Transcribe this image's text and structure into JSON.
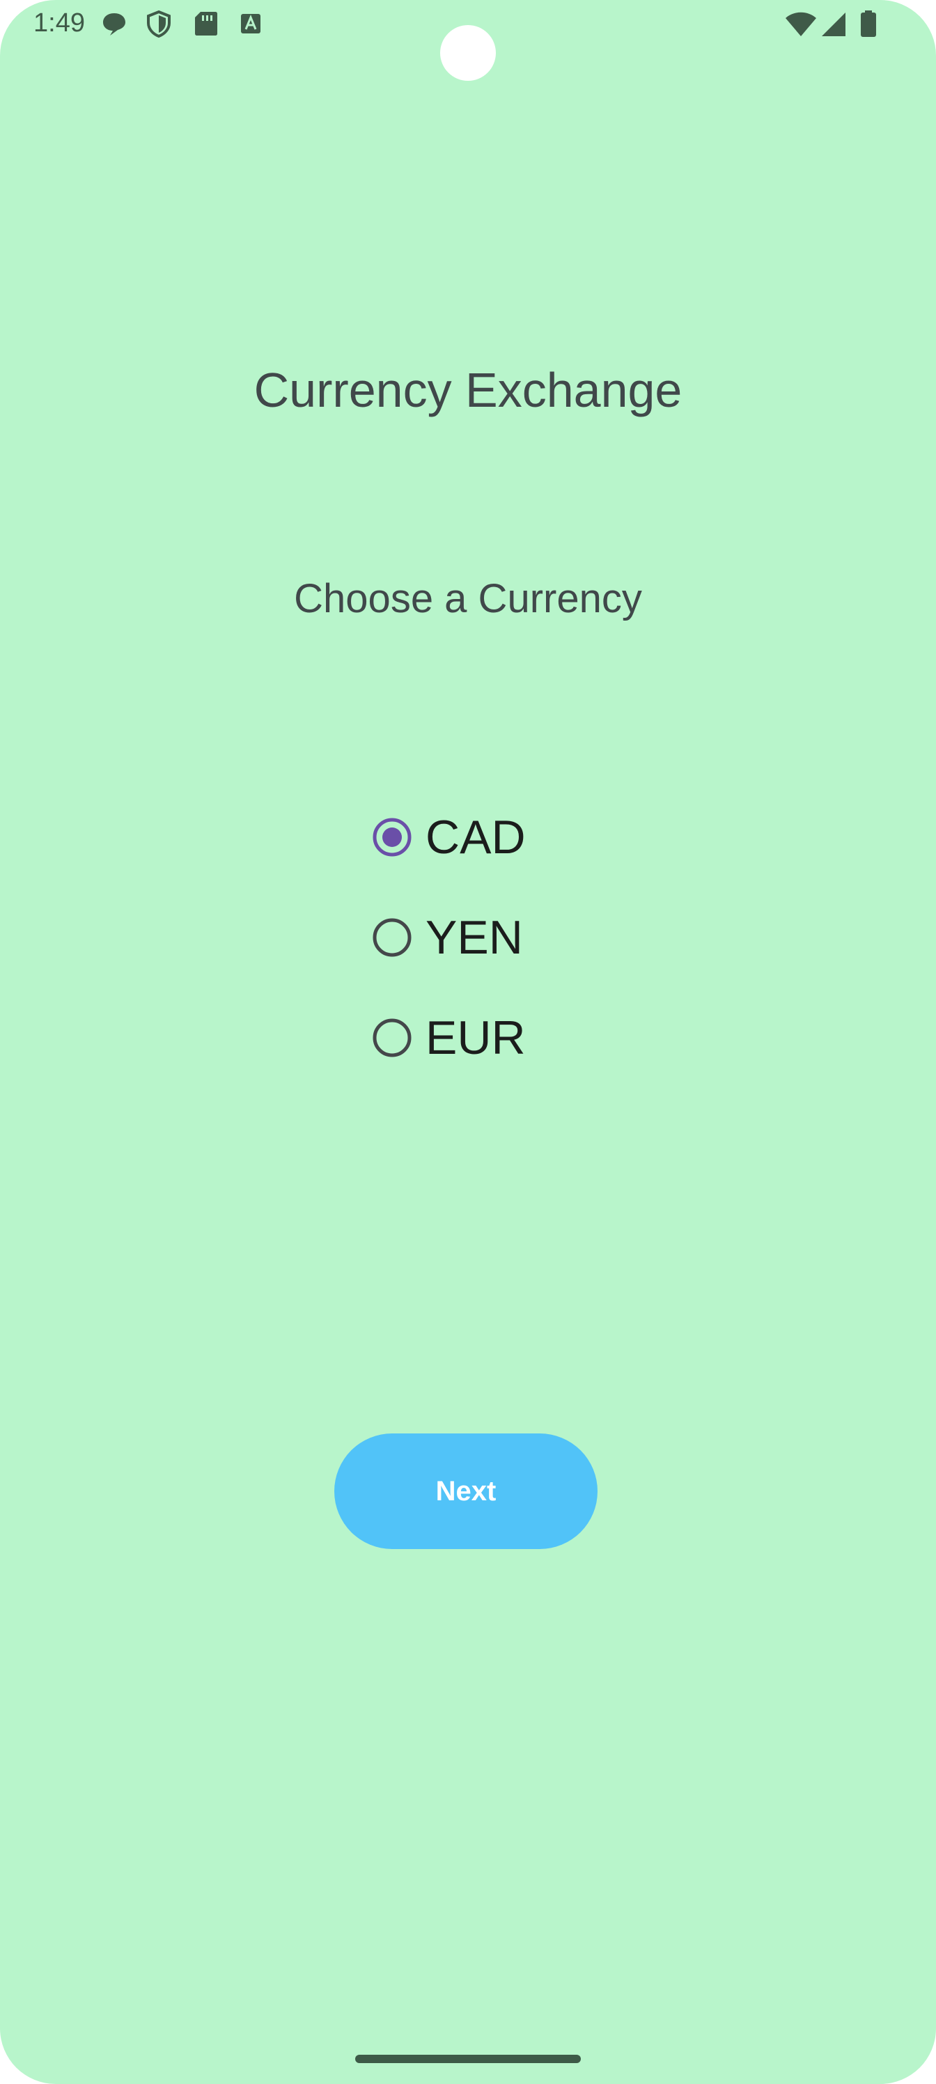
{
  "status_bar": {
    "time": "1:49",
    "left_icons": [
      "chat-bubble-icon",
      "shield-icon",
      "sd-card-icon",
      "text-a-icon"
    ],
    "right_icons": [
      "wifi-icon",
      "signal-icon",
      "battery-icon"
    ],
    "icon_color": "#3f5a48"
  },
  "main": {
    "title": "Currency Exchange",
    "subtitle": "Choose a Currency",
    "options": [
      {
        "label": "CAD",
        "selected": true
      },
      {
        "label": "YEN",
        "selected": false
      },
      {
        "label": "EUR",
        "selected": false
      }
    ],
    "next_label": "Next"
  },
  "colors": {
    "background": "#b8f5cb",
    "accent_radio": "#6a4fa8",
    "button": "#51c3f8",
    "button_text": "#ffffff"
  }
}
